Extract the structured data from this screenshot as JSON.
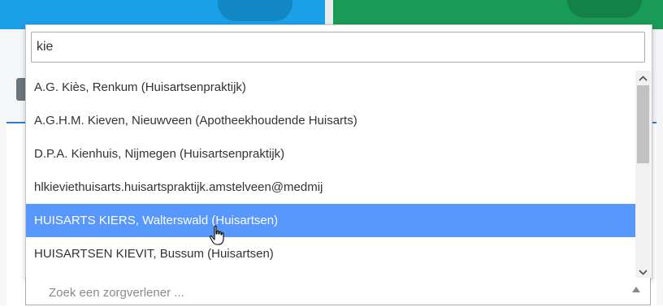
{
  "search": {
    "value": "kie"
  },
  "results": [
    {
      "label": "A.G. Kiès, Renkum (Huisartsenpraktijk)"
    },
    {
      "label": "A.G.H.M. Kieven, Nieuwveen (Apotheekhoudende Huisarts)"
    },
    {
      "label": "D.P.A. Kienhuis, Nijmegen (Huisartsenpraktijk)"
    },
    {
      "label": "hlkieviethuisarts.huisartspraktijk.amstelveen@medmij"
    },
    {
      "label": "HUISARTS KIERS, Walterswald (Huisartsen)",
      "highlighted": true
    },
    {
      "label": "HUISARTSEN KIEVIT, Bussum (Huisartsen)"
    }
  ],
  "select": {
    "placeholder": "Zoek een zorgverlener ..."
  },
  "icons": {
    "scroll_up": "chevron-up-icon",
    "scroll_down": "chevron-down-icon",
    "select_arrow": "triangle-up-icon",
    "cursor": "hand-pointer-icon"
  },
  "colors": {
    "highlight": "#5897fb",
    "header_blue": "#1aa0e6",
    "header_green": "#1a9a57"
  }
}
